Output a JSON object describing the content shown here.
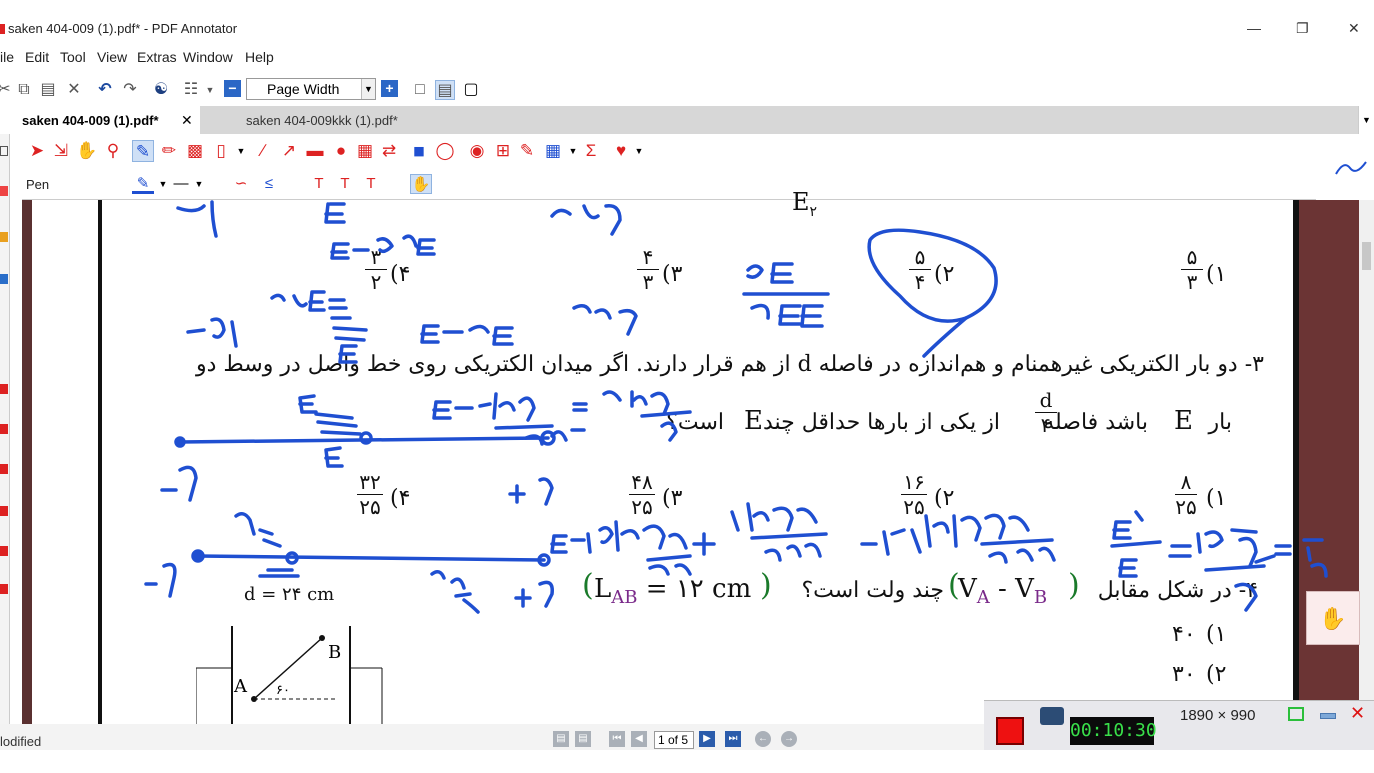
{
  "window": {
    "title": "saken 404-009 (1).pdf* - PDF Annotator"
  },
  "menu": [
    "ile",
    "Edit",
    "Tool",
    "View",
    "Extras",
    "Window",
    "Help"
  ],
  "toolbar": {
    "zoom_value": "Page Width"
  },
  "tabs": [
    {
      "label": "saken 404-009 (1).pdf*",
      "active": true
    },
    {
      "label": "saken 404-009kkk (1).pdf*",
      "active": false
    }
  ],
  "tools": {
    "current_tool": "Pen"
  },
  "document": {
    "top_fragment": "E",
    "top_sub": "۲",
    "q2_options": [
      {
        "num": "۵",
        "den": "۳",
        "label": "(۱"
      },
      {
        "num": "۵",
        "den": "۴",
        "label": "(۲"
      },
      {
        "num": "۴",
        "den": "۳",
        "label": "(۳"
      },
      {
        "num": "۳",
        "den": "۲",
        "label": "(۴"
      }
    ],
    "q3_line1": "۳- دو بار الکتریکی غیرهمنام و هم‌اندازه در فاصله d از هم قرار دارند. اگر میدان الکتریکی روی خط واصل در وسط دو",
    "q3_line2": "بار E باشد فاصله d/۴ از یکی از بارها حداقل چند E است؟",
    "q3_line2_parts": {
      "pre": "بار",
      "E": "E",
      "mid": "باشد فاصله",
      "frac_num": "d",
      "frac_den": "۴",
      "post": "از یکی از بارها حداقل چند",
      "E2": "E",
      "end": "است؟"
    },
    "q3_options": [
      {
        "num": "۸",
        "den": "۲۵",
        "label": "(۱"
      },
      {
        "num": "۱۶",
        "den": "۲۵",
        "label": "(۲"
      },
      {
        "num": "۴۸",
        "den": "۲۵",
        "label": "(۳"
      },
      {
        "num": "۳۲",
        "den": "۲۵",
        "label": "(۴"
      }
    ],
    "q4_text": "۴- در شکل مقابل",
    "q4_vab": "V",
    "q4_a": "A",
    "q4_b": "B",
    "q4_dash": "-",
    "q4_mid": "چند ولت است؟",
    "q4_lab": "L",
    "q4_lab_sub": "AB",
    "q4_lab_val": "= ۱۲ cm",
    "q4_options": [
      {
        "value": "۴۰",
        "label": "(۱"
      },
      {
        "value": "۳۰",
        "label": "(۲"
      }
    ],
    "figure": {
      "d_label": "d = ۲۴ cm",
      "angle_label": "۶۰",
      "point_a": "A",
      "point_b": "B"
    }
  },
  "status": {
    "modified": "lodified",
    "page_indicator": "1 of 5"
  },
  "recorder": {
    "time": "00:10:30",
    "dimensions": "1890 × 990"
  },
  "colors": {
    "ink": "#1f4fd1",
    "recorder_green": "#39e04a",
    "accent": "#2b5cab"
  }
}
